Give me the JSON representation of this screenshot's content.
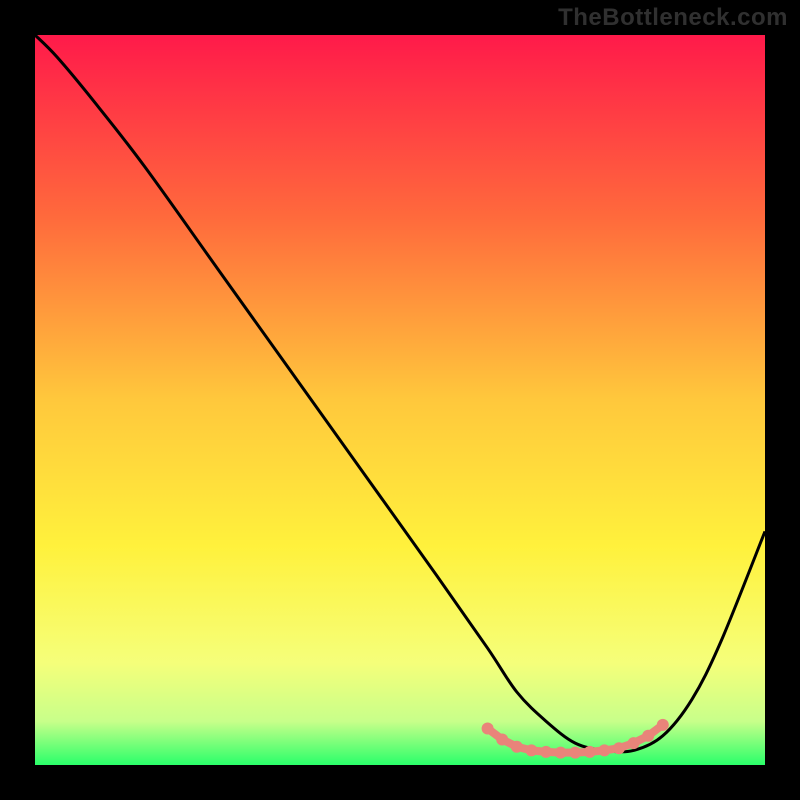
{
  "watermark": "TheBottleneck.com",
  "chart_data": {
    "type": "line",
    "title": "",
    "xlabel": "",
    "ylabel": "",
    "xlim": [
      0,
      100
    ],
    "ylim": [
      0,
      100
    ],
    "series": [
      {
        "name": "bottleneck-curve",
        "x": [
          0,
          3,
          8,
          15,
          25,
          35,
          45,
          55,
          62,
          66,
          70,
          74,
          78,
          82,
          86,
          90,
          94,
          100
        ],
        "y": [
          100,
          97,
          91,
          82,
          68,
          54,
          40,
          26,
          16,
          10,
          6,
          3,
          2,
          2,
          4,
          9,
          17,
          32
        ]
      },
      {
        "name": "bottleneck-markers",
        "x": [
          62,
          64,
          66,
          68,
          70,
          72,
          74,
          76,
          78,
          80,
          82,
          84,
          86
        ],
        "y": [
          5,
          3.5,
          2.5,
          2,
          1.8,
          1.7,
          1.7,
          1.8,
          2,
          2.3,
          3,
          4,
          5.5
        ]
      }
    ],
    "gradient_stops": [
      {
        "offset": 0,
        "color": "#ff1a4a"
      },
      {
        "offset": 25,
        "color": "#ff6a3c"
      },
      {
        "offset": 50,
        "color": "#ffc83c"
      },
      {
        "offset": 70,
        "color": "#fff13c"
      },
      {
        "offset": 86,
        "color": "#f5ff7a"
      },
      {
        "offset": 94,
        "color": "#c8ff8a"
      },
      {
        "offset": 100,
        "color": "#2aff6a"
      }
    ]
  }
}
